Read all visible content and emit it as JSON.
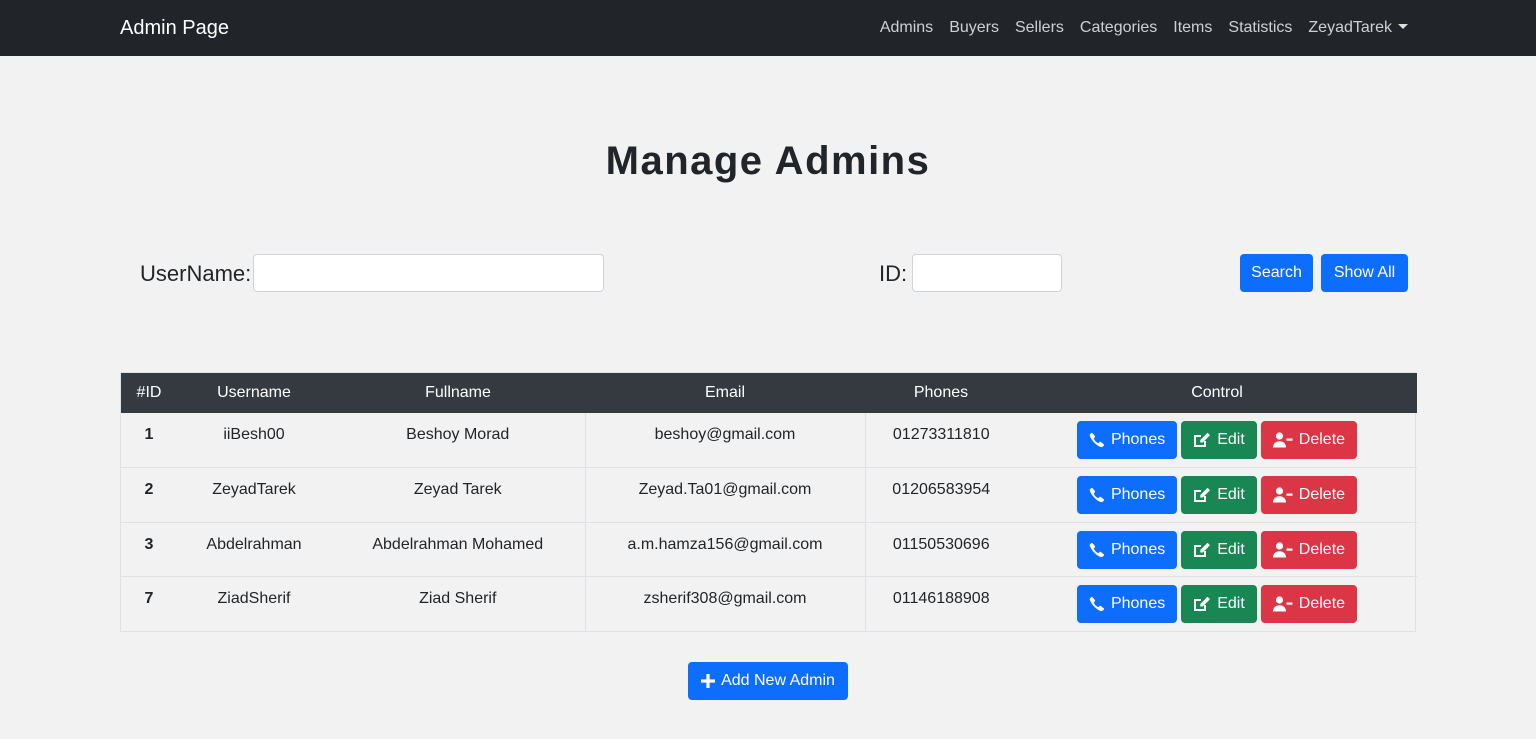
{
  "navbar": {
    "brand": "Admin Page",
    "links": [
      "Admins",
      "Buyers",
      "Sellers",
      "Categories",
      "Items",
      "Statistics"
    ],
    "user": "ZeyadTarek"
  },
  "page": {
    "title": "Manage Admins"
  },
  "search": {
    "username_label": "UserName:",
    "username_value": "",
    "id_label": "ID:",
    "id_value": "",
    "search_button": "Search",
    "show_all_button": "Show All"
  },
  "table": {
    "headers": [
      "#ID",
      "Username",
      "Fullname",
      "Email",
      "Phones",
      "Control"
    ],
    "rows": [
      {
        "id": "1",
        "username": "iiBesh00",
        "fullname": "Beshoy Morad",
        "email": "beshoy@gmail.com",
        "phone": "01273311810"
      },
      {
        "id": "2",
        "username": "ZeyadTarek",
        "fullname": "Zeyad Tarek",
        "email": "Zeyad.Ta01@gmail.com",
        "phone": "01206583954"
      },
      {
        "id": "3",
        "username": "Abdelrahman",
        "fullname": "Abdelrahman Mohamed",
        "email": "a.m.hamza156@gmail.com",
        "phone": "01150530696"
      },
      {
        "id": "7",
        "username": "ZiadSherif",
        "fullname": "Ziad Sherif",
        "email": "zsherif308@gmail.com",
        "phone": "01146188908"
      }
    ],
    "controls": {
      "phones": "Phones",
      "edit": "Edit",
      "delete": "Delete"
    }
  },
  "add_button": "Add New Admin",
  "colors": {
    "primary": "#0d6efd",
    "success": "#198754",
    "danger": "#dc3545",
    "navbar": "#212529",
    "table_head": "#343a40"
  }
}
